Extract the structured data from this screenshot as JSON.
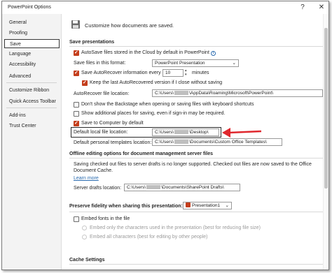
{
  "window": {
    "title": "PowerPoint Options",
    "help_glyph": "?",
    "close_glyph": "✕"
  },
  "sidebar": {
    "items": [
      {
        "label": "General"
      },
      {
        "label": "Proofing"
      },
      {
        "label": "Save"
      },
      {
        "label": "Language"
      },
      {
        "label": "Accessibility"
      },
      {
        "label": "Advanced"
      },
      {
        "label": "Customize Ribbon"
      },
      {
        "label": "Quick Access Toolbar"
      },
      {
        "label": "Add-ins"
      },
      {
        "label": "Trust Center"
      }
    ],
    "selected": "Save"
  },
  "header": {
    "text": "Customize how documents are saved."
  },
  "save_presentations": {
    "heading": "Save presentations",
    "autosave_label": "AutoSave files stored in the Cloud by default in PowerPoint",
    "autosave_checked": true,
    "format_label": "Save files in this format:",
    "format_value": "PowerPoint Presentation",
    "autorecover_label": "Save AutoRecover information every",
    "autorecover_checked": true,
    "autorecover_minutes": "10",
    "minutes_label": "minutes",
    "keep_last_label": "Keep the last AutoRecovered version if I close without saving",
    "keep_last_checked": true,
    "autorecover_location_label": "AutoRecover file location:",
    "autorecover_location_prefix": "C:\\Users\\",
    "autorecover_location_suffix": "\\AppData\\Roaming\\Microsoft\\PowerPoint\\",
    "backstage_label": "Don't show the Backstage when opening or saving files with keyboard shortcuts",
    "backstage_checked": false,
    "additional_places_label": "Show additional places for saving, even if sign-in may be required.",
    "additional_places_checked": false,
    "save_to_computer_label": "Save to Computer by default",
    "save_to_computer_checked": true,
    "default_local_label": "Default local file location:",
    "default_local_prefix": "C:\\Users\\",
    "default_local_suffix": "\\Desktop\\",
    "default_templates_label": "Default personal templates location:",
    "default_templates_prefix": "C:\\Users\\",
    "default_templates_suffix": "\\Documents\\Custom Office Templates\\"
  },
  "offline": {
    "heading": "Offline editing options for document management server files",
    "desc_line1": "Saving checked out files to server drafts is no longer supported. Checked out files are now saved to the Office",
    "desc_line2": "Document Cache.",
    "learn_more": "Learn more",
    "server_drafts_label": "Server drafts location:",
    "server_drafts_prefix": "C:\\Users\\",
    "server_drafts_suffix": "\\Documents\\SharePoint Drafts\\"
  },
  "fidelity": {
    "heading": "Preserve fidelity when sharing this presentation:",
    "presentation_value": "Presentation1",
    "embed_fonts_label": "Embed fonts in the file",
    "embed_fonts_checked": false,
    "embed_only_label": "Embed only the characters used in the presentation (best for reducing file size)",
    "embed_all_label": "Embed all characters (best for editing by other people)"
  },
  "cache": {
    "heading": "Cache Settings"
  },
  "colors": {
    "accent": "#c43e1c",
    "callout": "#e0282e",
    "highlight_border": "#2a2a2a"
  }
}
